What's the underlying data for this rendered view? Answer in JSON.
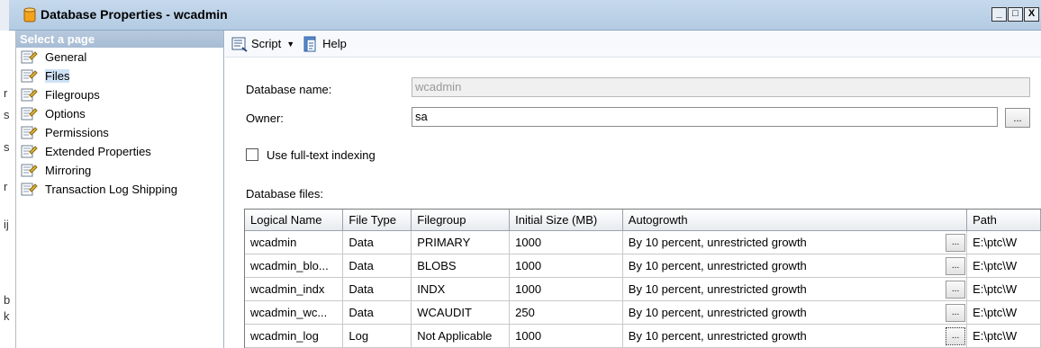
{
  "window": {
    "title": "Database Properties - wcadmin",
    "controls": {
      "minimize": "_",
      "maximize": "□",
      "close": "X"
    }
  },
  "left_strip": {
    "chars": [
      "r",
      "s",
      "s",
      "r",
      "ij",
      "b",
      "k"
    ]
  },
  "sidebar": {
    "header": "Select a page",
    "items": [
      {
        "label": "General",
        "icon": "page-wrench-icon"
      },
      {
        "label": "Files",
        "icon": "page-wrench-icon",
        "selected": true
      },
      {
        "label": "Filegroups",
        "icon": "page-wrench-icon"
      },
      {
        "label": "Options",
        "icon": "page-wrench-icon"
      },
      {
        "label": "Permissions",
        "icon": "page-wrench-icon"
      },
      {
        "label": "Extended Properties",
        "icon": "page-wrench-icon"
      },
      {
        "label": "Mirroring",
        "icon": "page-wrench-icon"
      },
      {
        "label": "Transaction Log Shipping",
        "icon": "page-wrench-icon"
      }
    ]
  },
  "toolbar": {
    "script_label": "Script",
    "help_label": "Help"
  },
  "form": {
    "db_name_label": "Database name:",
    "db_name_value": "wcadmin",
    "owner_label": "Owner:",
    "owner_value": "sa",
    "browse_label": "...",
    "fulltext_label": "Use full-text indexing",
    "fulltext_checked": false,
    "files_label": "Database files:"
  },
  "grid": {
    "columns": [
      "Logical Name",
      "File Type",
      "Filegroup",
      "Initial Size (MB)",
      "Autogrowth",
      "Path"
    ],
    "ellipsis": "...",
    "rows": [
      {
        "name": "wcadmin",
        "type": "Data",
        "filegroup": "PRIMARY",
        "size": "1000",
        "autogrowth": "By 10 percent, unrestricted growth",
        "path": "E:\\ptc\\W"
      },
      {
        "name": "wcadmin_blo...",
        "type": "Data",
        "filegroup": "BLOBS",
        "size": "1000",
        "autogrowth": "By 10 percent, unrestricted growth",
        "path": "E:\\ptc\\W"
      },
      {
        "name": "wcadmin_indx",
        "type": "Data",
        "filegroup": "INDX",
        "size": "1000",
        "autogrowth": "By 10 percent, unrestricted growth",
        "path": "E:\\ptc\\W"
      },
      {
        "name": "wcadmin_wc...",
        "type": "Data",
        "filegroup": "WCAUDIT",
        "size": "250",
        "autogrowth": "By 10 percent, unrestricted growth",
        "path": "E:\\ptc\\W"
      },
      {
        "name": "wcadmin_log",
        "type": "Log",
        "filegroup": "Not Applicable",
        "size": "1000",
        "autogrowth": "By 10 percent, unrestricted growth",
        "path": "E:\\ptc\\W"
      }
    ]
  }
}
